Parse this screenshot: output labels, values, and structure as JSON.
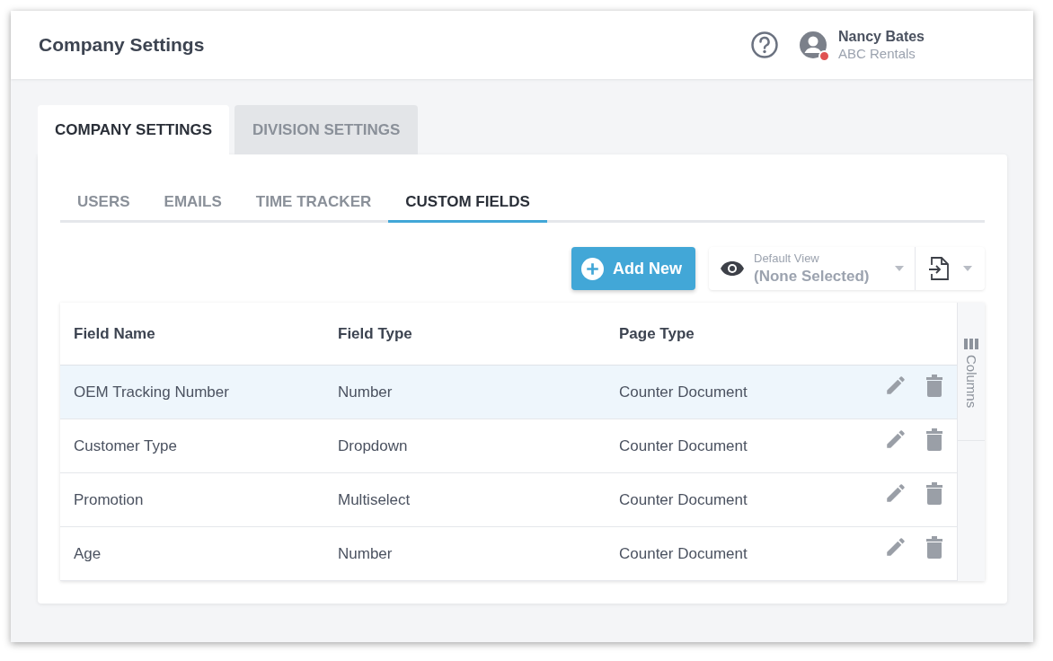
{
  "header": {
    "title": "Company Settings",
    "user": {
      "name": "Nancy Bates",
      "company": "ABC Rentals",
      "alert": true
    }
  },
  "tabs": [
    {
      "label": "COMPANY SETTINGS",
      "selected": true
    },
    {
      "label": "DIVISION SETTINGS",
      "selected": false
    }
  ],
  "subtabs": [
    {
      "label": "USERS",
      "selected": false
    },
    {
      "label": "EMAILS",
      "selected": false
    },
    {
      "label": "TIME TRACKER",
      "selected": false
    },
    {
      "label": "CUSTOM FIELDS",
      "selected": true
    }
  ],
  "toolbar": {
    "add_button": "Add New",
    "view": {
      "label": "Default View",
      "value": "(None Selected)"
    }
  },
  "table": {
    "columns": [
      "Field Name",
      "Field Type",
      "Page Type"
    ],
    "rows": [
      {
        "cells": [
          "OEM Tracking Number",
          "Number",
          "Counter Document"
        ],
        "selected": true
      },
      {
        "cells": [
          "Customer Type",
          "Dropdown",
          "Counter Document"
        ],
        "selected": false
      },
      {
        "cells": [
          "Promotion",
          "Multiselect",
          "Counter Document"
        ],
        "selected": false
      },
      {
        "cells": [
          "Age",
          "Number",
          "Counter Document"
        ],
        "selected": false
      }
    ],
    "side_panel": "Columns"
  }
}
